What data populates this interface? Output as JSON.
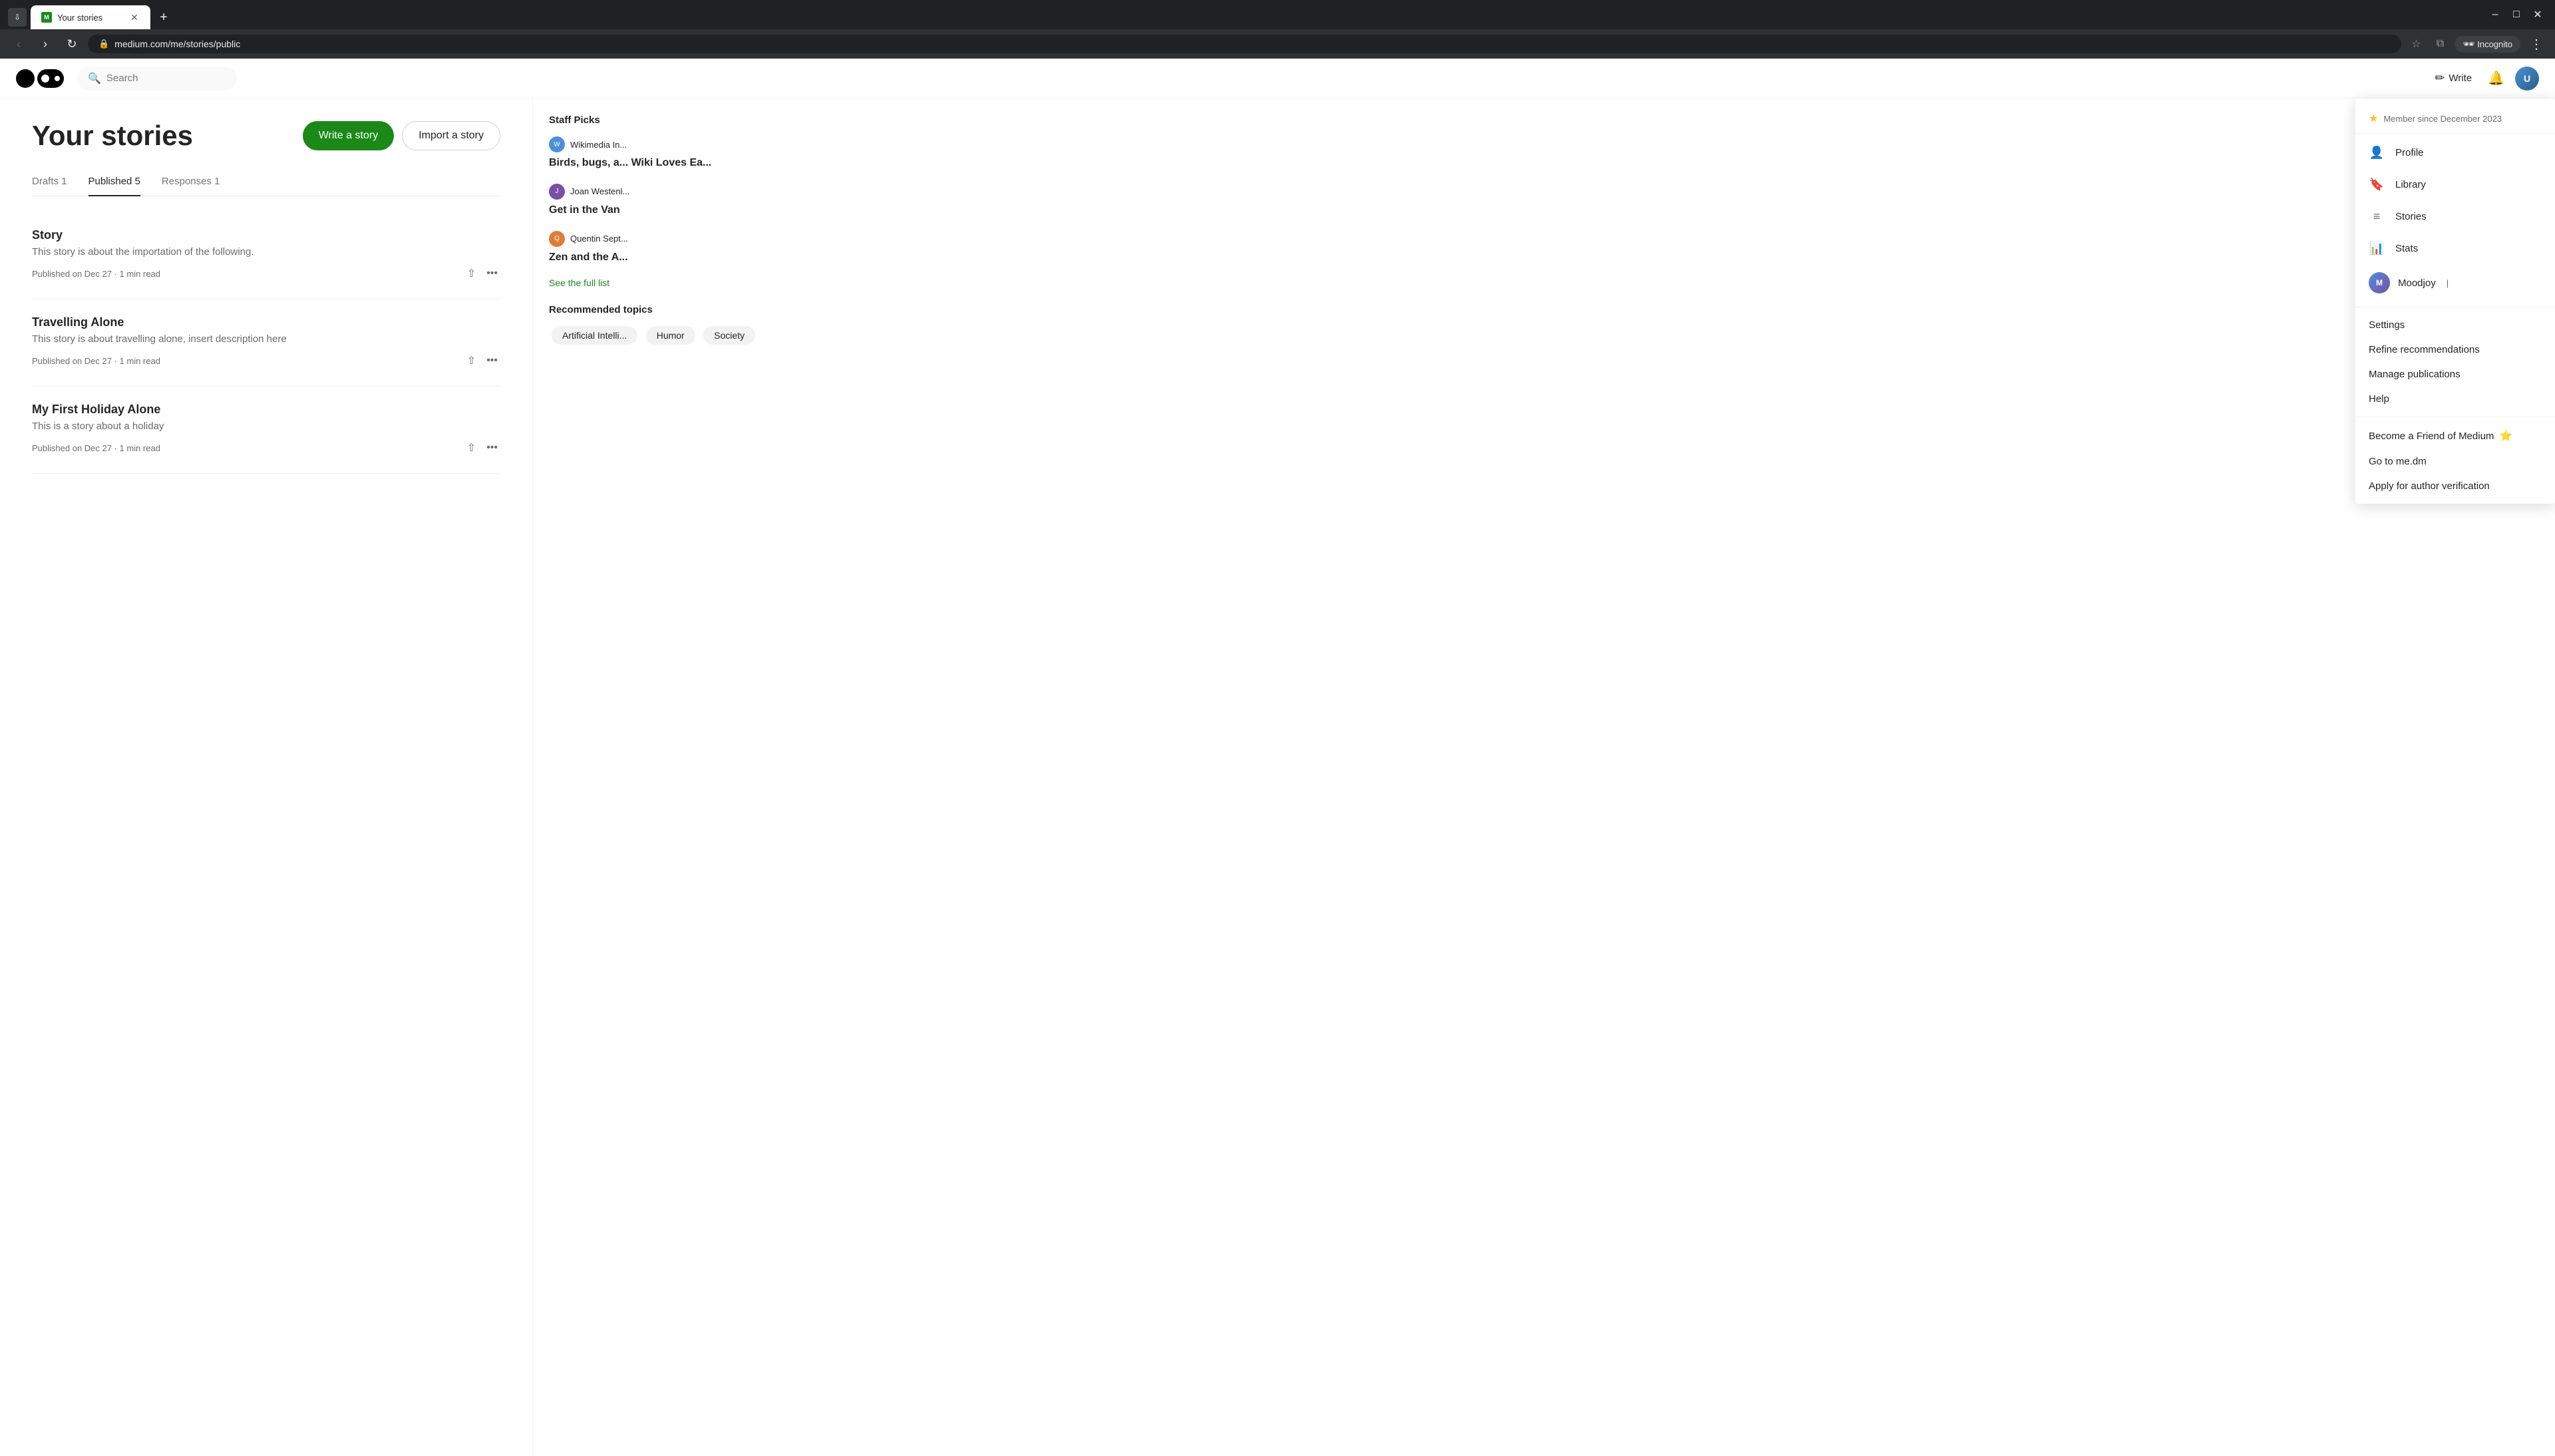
{
  "browser": {
    "tab_title": "Your stories",
    "favicon_text": "M",
    "address": "medium.com/me/stories/public",
    "incognito_label": "Incognito",
    "nav_back": "‹",
    "nav_forward": "›",
    "nav_refresh": "↻"
  },
  "header": {
    "search_placeholder": "Search",
    "write_label": "Write",
    "logo_text": "Medium"
  },
  "page": {
    "title": "Your stories",
    "write_story_btn": "Write a story",
    "import_story_btn": "Import a story"
  },
  "tabs": {
    "drafts_label": "Drafts 1",
    "published_label": "Published 5",
    "responses_label": "Responses 1"
  },
  "stories": [
    {
      "title": "Story",
      "excerpt": "This story is about the importation of the following.",
      "published": "Published on Dec 27 · 1 min read"
    },
    {
      "title": "Travelling Alone",
      "excerpt": "This story is about travelling alone, insert description here",
      "published": "Published on Dec 27 · 1 min read"
    },
    {
      "title": "My First Holiday Alone",
      "excerpt": "This is a story about a holiday",
      "published": "Published on Dec 27 · 1 min read"
    }
  ],
  "sidebar": {
    "staff_picks_title": "Staff Picks",
    "picks": [
      {
        "author": "Wikimedia In...",
        "title": "Birds, bugs, a... Wiki Loves Ea..."
      },
      {
        "author": "Joan Westenl...",
        "title": "Get in the Van"
      },
      {
        "author": "Quentin Sept...",
        "title": "Zen and the A..."
      }
    ],
    "see_full_list": "See the full list",
    "recommended_title": "Recommended topics",
    "tags": [
      "Artificial Intelli...",
      "Humor",
      "Society"
    ]
  },
  "dropdown": {
    "member_since": "Member since December 2023",
    "profile_label": "Profile",
    "library_label": "Library",
    "stories_label": "Stories",
    "stats_label": "Stats",
    "publication_name": "Moodjoy",
    "settings_label": "Settings",
    "refine_label": "Refine recommendations",
    "manage_label": "Manage publications",
    "help_label": "Help",
    "friend_label": "Become a Friend of Medium",
    "me_dm_label": "Go to me.dm",
    "verify_label": "Apply for author verification",
    "cursor_pos": "after Moodjoy label"
  }
}
